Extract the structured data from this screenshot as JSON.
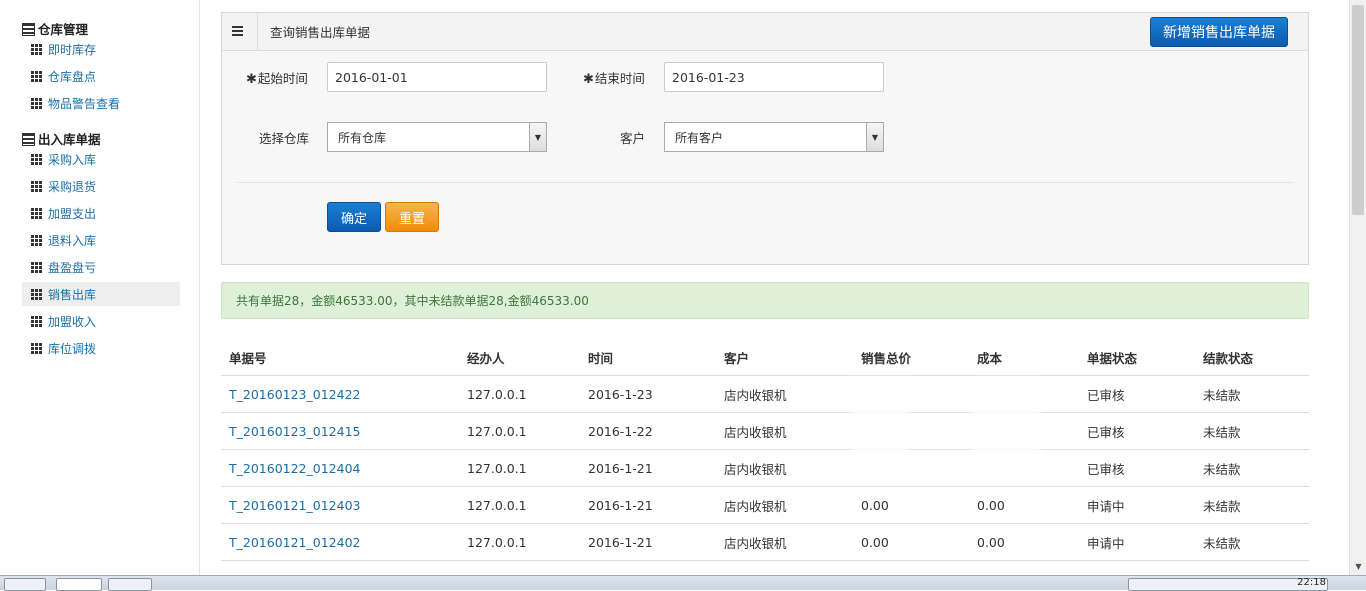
{
  "sidebar": {
    "sections": [
      {
        "title": "仓库管理",
        "items": [
          "即时库存",
          "仓库盘点",
          "物品警告查看"
        ]
      },
      {
        "title": "出入库单据",
        "items": [
          "采购入库",
          "采购退货",
          "加盟支出",
          "退料入库",
          "盘盈盘亏",
          "销售出库",
          "加盟收入",
          "库位调拨"
        ]
      }
    ],
    "active_item": "销售出库"
  },
  "panel": {
    "title": "查询销售出库单据",
    "new_button": "新增销售出库单据",
    "start_label": "起始时间",
    "start_value": "2016-01-01",
    "end_label": "结束时间",
    "end_value": "2016-01-23",
    "star": "✱",
    "warehouse_label": "选择仓库",
    "warehouse_value": "所有仓库",
    "customer_label": "客户",
    "customer_value": "所有客户",
    "ok_button": "确定",
    "reset_button": "重置"
  },
  "summary": "共有单据28，金额46533.00，其中未结款单据28,金额46533.00",
  "table": {
    "headers": [
      "单据号",
      "经办人",
      "时间",
      "客户",
      "销售总价",
      "成本",
      "单据状态",
      "结款状态"
    ],
    "rows": [
      [
        "T_20160123_012422",
        "127.0.0.1",
        "2016-1-23",
        "店内收银机",
        "",
        "",
        "已审核",
        "未结款"
      ],
      [
        "T_20160123_012415",
        "127.0.0.1",
        "2016-1-22",
        "店内收银机",
        "",
        "",
        "已审核",
        "未结款"
      ],
      [
        "T_20160122_012404",
        "127.0.0.1",
        "2016-1-21",
        "店内收银机",
        "",
        "",
        "已审核",
        "未结款"
      ],
      [
        "T_20160121_012403",
        "127.0.0.1",
        "2016-1-21",
        "店内收银机",
        "0.00",
        "0.00",
        "申请中",
        "未结款"
      ],
      [
        "T_20160121_012402",
        "127.0.0.1",
        "2016-1-21",
        "店内收银机",
        "0.00",
        "0.00",
        "申请中",
        "未结款"
      ]
    ]
  },
  "taskbar": {
    "clock": "22:18"
  },
  "colors": {
    "primary": "#0d5bb0",
    "warning": "#f08d0a",
    "link": "#1a6ea8",
    "success_bg": "#dff0d8"
  }
}
